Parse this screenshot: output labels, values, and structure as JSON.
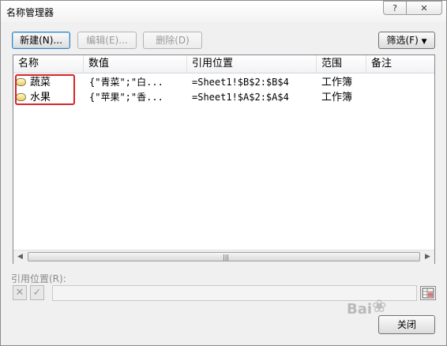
{
  "window": {
    "title": "名称管理器",
    "help_label": "?",
    "close_label": "✕"
  },
  "toolbar": {
    "new_label": "新建(N)...",
    "edit_label": "编辑(E)...",
    "delete_label": "删除(D)",
    "filter_label": "筛选(F)",
    "filter_arrow": "▼"
  },
  "table": {
    "columns": [
      "名称",
      "数值",
      "引用位置",
      "范围",
      "备注"
    ],
    "rows": [
      {
        "name": "蔬菜",
        "value": "{\"青菜\";\"白...",
        "refers_to": "=Sheet1!$B$2:$B$4",
        "scope": "工作簿",
        "comment": ""
      },
      {
        "name": "水果",
        "value": "{\"苹果\";\"香...",
        "refers_to": "=Sheet1!$A$2:$A$4",
        "scope": "工作簿",
        "comment": ""
      }
    ],
    "scroll_left": "◀",
    "scroll_right": "▶",
    "scroll_grip": "|||"
  },
  "refers_to_panel": {
    "label": "引用位置(R):",
    "cancel_symbol": "✕",
    "confirm_symbol": "✓",
    "value": ""
  },
  "footer": {
    "close_label": "关闭"
  },
  "watermark": {
    "text": "Bai",
    "paw": "❀"
  },
  "colors": {
    "highlight": "#d6262b",
    "accent": "#3c7fb1"
  }
}
